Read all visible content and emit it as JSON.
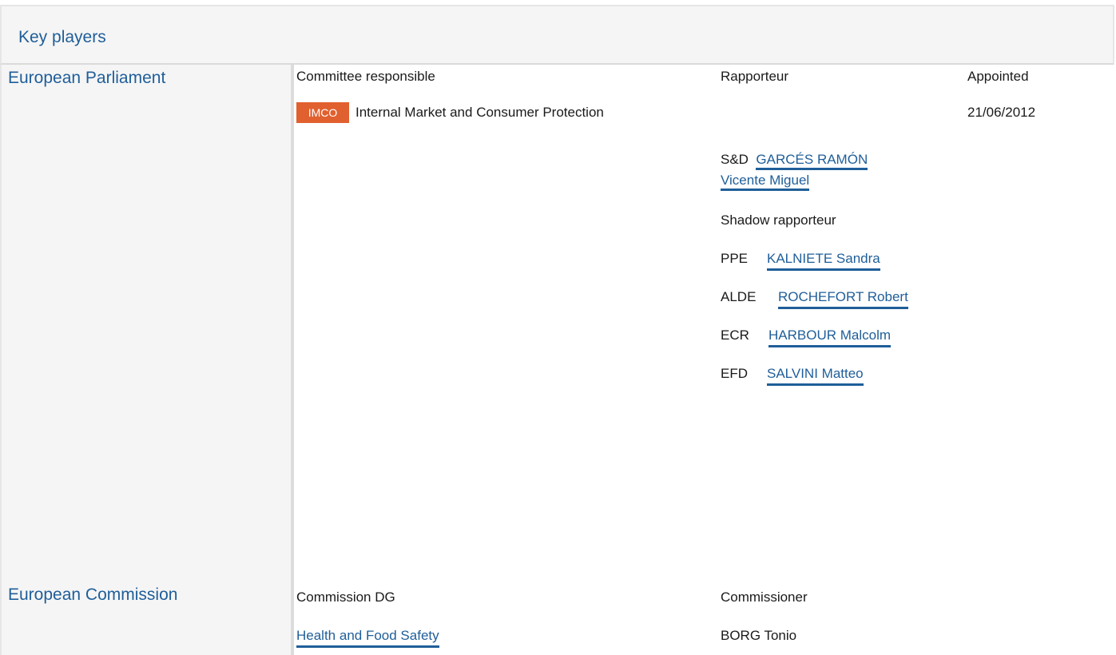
{
  "header": {
    "title": "Key players"
  },
  "parliament": {
    "label": "European Parliament",
    "committee_header": "Committee responsible",
    "rapporteur_header": "Rapporteur",
    "appointed_header": "Appointed",
    "committee_code": "IMCO",
    "committee_name": "Internal Market and Consumer Protection",
    "appointed_date": "21/06/2012",
    "rapporteur": {
      "group": "S&D",
      "name_line1": "GARCÉS RAMÓN",
      "name_line2": "Vicente Miguel"
    },
    "shadow_header": "Shadow rapporteur",
    "shadows": [
      {
        "group": "PPE",
        "name": "KALNIETE Sandra"
      },
      {
        "group": "ALDE",
        "name": "ROCHEFORT Robert"
      },
      {
        "group": "ECR",
        "name": "HARBOUR Malcolm"
      },
      {
        "group": "EFD",
        "name": "SALVINI Matteo"
      }
    ]
  },
  "commission": {
    "label": "European Commission",
    "dg_header": "Commission DG",
    "commissioner_header": "Commissioner",
    "dg_name": "Health and Food Safety",
    "commissioner_name": "BORG Tonio"
  }
}
